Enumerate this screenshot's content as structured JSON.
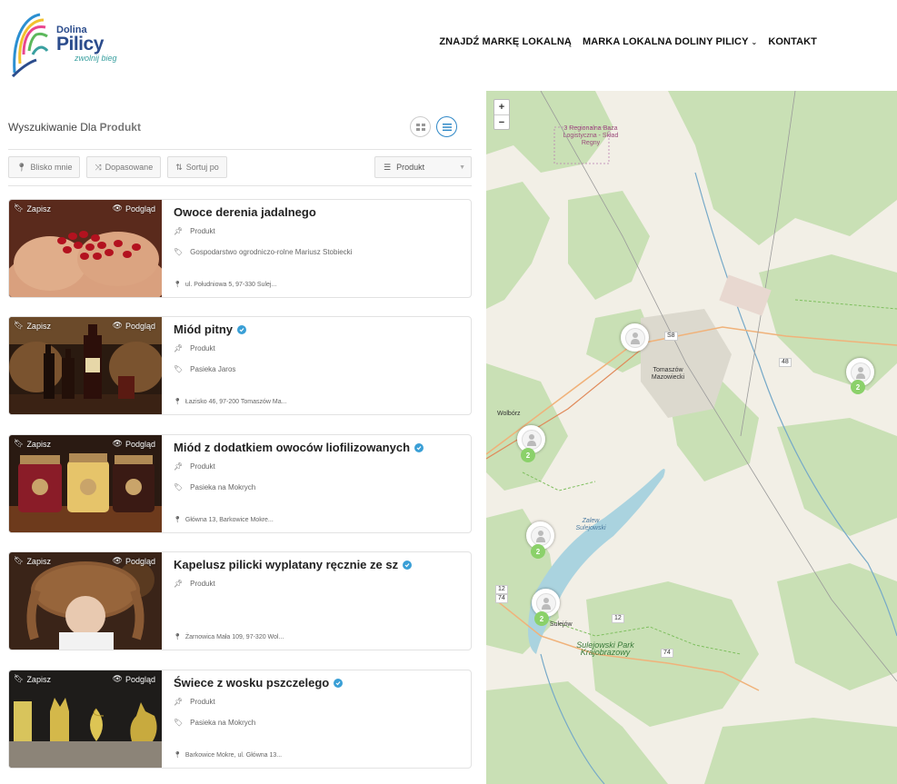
{
  "brand": {
    "name_top": "Dolina",
    "name_main": "Pilicy",
    "tagline": "zwolnij bieg"
  },
  "nav": {
    "items": [
      {
        "label": "ZNAJDŹ MARKĘ LOKALNĄ"
      },
      {
        "label": "MARKA LOKALNA DOLINY PILICY"
      },
      {
        "label": "KONTAKT"
      }
    ]
  },
  "search": {
    "title_prefix": "Wyszukiwanie Dla",
    "title_term": "Produkt",
    "filters": {
      "near_label": "Blisko mnie",
      "matched_label": "Dopasowane",
      "sort_label": "Sortuj po"
    },
    "category_select": "Produkt"
  },
  "card_labels": {
    "save": "Zapisz",
    "preview": "Podgląd"
  },
  "listings": [
    {
      "title": "Owoce derenia jadalnego",
      "verified": false,
      "category": "Produkt",
      "producer": "Gospodarstwo ogrodniczo-rolne Mariusz Stobiecki",
      "address": "ul. Południowa 5, 97-330 Sulej..."
    },
    {
      "title": "Miód pitny",
      "verified": true,
      "category": "Produkt",
      "producer": "Pasieka Jaros",
      "address": "Łazisko 46, 97-200 Tomaszów Ma..."
    },
    {
      "title": "Miód z dodatkiem owoców liofilizowanych",
      "verified": true,
      "category": "Produkt",
      "producer": "Pasieka na Mokrych",
      "address": "Główna 13, Barkowice Mokre..."
    },
    {
      "title": "Kapelusz pilicki wyplatany ręcznie ze sz",
      "verified": true,
      "category": "Produkt",
      "producer": "",
      "address": "Żarnowica Mała 109, 97-320 Wol..."
    },
    {
      "title": "Świece z wosku pszczelego",
      "verified": true,
      "category": "Produkt",
      "producer": "Pasieka na Mokrych",
      "address": "Barkowice Mokre, ul. Główna 13..."
    }
  ],
  "map": {
    "zoom_in": "+",
    "zoom_out": "−",
    "labels": {
      "logistics": "3 Regionalna Baza Logistyczna - Skład Regny",
      "city": "Tomaszów Mazowiecki",
      "wolborz": "Wolbórz",
      "sulejow": "Sulejów",
      "park": "Sulejowski Park Krajobrazowy",
      "reservoir": "Zalew Sulejowski",
      "road_s8": "S8",
      "road_48": "48",
      "road_12a": "12",
      "road_74a": "74",
      "road_12b": "12",
      "road_74b": "74"
    },
    "cluster_counts": [
      "2",
      "2",
      "2",
      "2"
    ]
  },
  "colors": {
    "accent": "#2f88c7",
    "verified": "#3a9fd6",
    "cluster": "#8bd16a",
    "forest": "#c7dfb2",
    "road": "#f0b27a"
  }
}
